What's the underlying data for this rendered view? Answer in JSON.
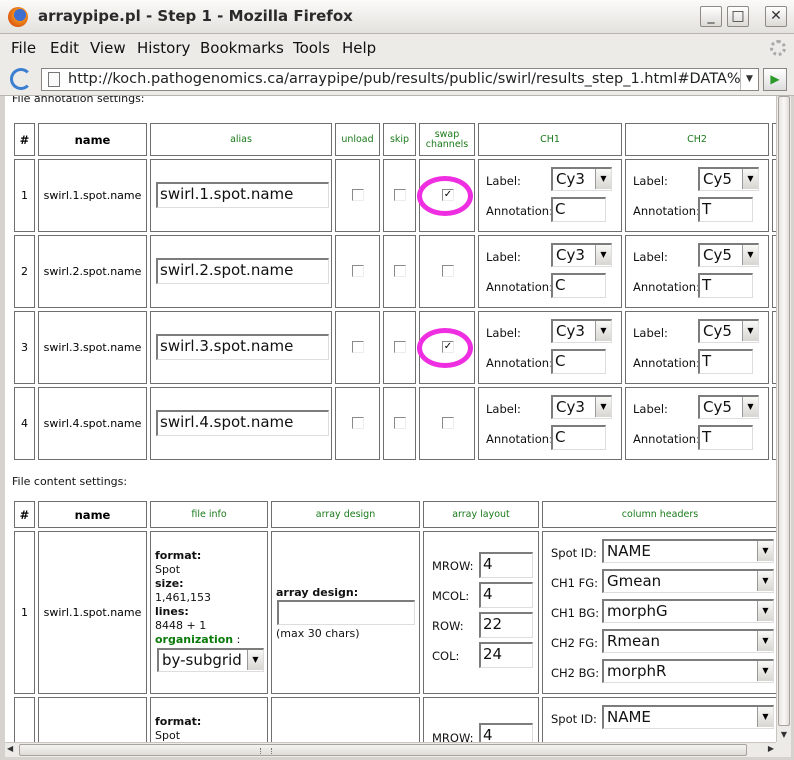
{
  "window": {
    "title": "arraypipe.pl - Step 1 - Mozilla Firefox",
    "min": "_",
    "max": "□",
    "close": "✕"
  },
  "menu": [
    "File",
    "Edit",
    "View",
    "History",
    "Bookmarks",
    "Tools",
    "Help"
  ],
  "url": "http://koch.pathogenomics.ca/arraypipe/pub/results/public/swirl/results_step_1.html#DATA%",
  "annotation": {
    "section_label": "File annotation settings:",
    "headers": {
      "num": "#",
      "name": "name",
      "alias": "alias",
      "unload": "unload",
      "skip": "skip",
      "swap": "swap channels",
      "ch1": "CH1",
      "ch2": "CH2"
    },
    "field_labels": {
      "label": "Label:",
      "annotation": "Annotation:"
    },
    "rows": [
      {
        "num": "1",
        "name": "swirl.1.spot.name",
        "alias": "swirl.1.spot.name",
        "swap": "✓",
        "ch1_label": "Cy3",
        "ch1_annot": "C",
        "ch2_label": "Cy5",
        "ch2_annot": "T"
      },
      {
        "num": "2",
        "name": "swirl.2.spot.name",
        "alias": "swirl.2.spot.name",
        "swap": "",
        "ch1_label": "Cy3",
        "ch1_annot": "C",
        "ch2_label": "Cy5",
        "ch2_annot": "T"
      },
      {
        "num": "3",
        "name": "swirl.3.spot.name",
        "alias": "swirl.3.spot.name",
        "swap": "✓",
        "ch1_label": "Cy3",
        "ch1_annot": "C",
        "ch2_label": "Cy5",
        "ch2_annot": "T"
      },
      {
        "num": "4",
        "name": "swirl.4.spot.name",
        "alias": "swirl.4.spot.name",
        "swap": "",
        "ch1_label": "Cy3",
        "ch1_annot": "C",
        "ch2_label": "Cy5",
        "ch2_annot": "T"
      }
    ]
  },
  "content_settings": {
    "section_label": "File content settings:",
    "headers": {
      "num": "#",
      "name": "name",
      "file_info": "file info",
      "array_design": "array design",
      "array_layout": "array layout",
      "column_headers": "column headers"
    },
    "row1": {
      "num": "1",
      "name": "swirl.1.spot.name",
      "format_label": "format:",
      "format": "Spot",
      "size_label": "size:",
      "size": "1,461,153",
      "lines_label": "lines:",
      "lines": "8448 + 1",
      "org_label": "organization",
      "org_colon": " :",
      "org_value": "by-subgrid",
      "array_design_label": "array design:",
      "array_design_value": "",
      "array_design_hint": "(max 30 chars)",
      "layout": [
        {
          "k": "MROW:",
          "v": "4"
        },
        {
          "k": "MCOL:",
          "v": "4"
        },
        {
          "k": "ROW:",
          "v": "22"
        },
        {
          "k": "COL:",
          "v": "24"
        }
      ],
      "columns": [
        {
          "k": "Spot ID:",
          "v": "NAME"
        },
        {
          "k": "CH1 FG:",
          "v": "Gmean"
        },
        {
          "k": "CH1 BG:",
          "v": "morphG"
        },
        {
          "k": "CH2 FG:",
          "v": "Rmean"
        },
        {
          "k": "CH2 BG:",
          "v": "morphR"
        }
      ]
    },
    "row2": {
      "format_label": "format:",
      "format": "Spot",
      "mrow_label": "MROW:",
      "mrow": "4",
      "spot_label": "Spot ID:",
      "spot": "NAME"
    }
  }
}
